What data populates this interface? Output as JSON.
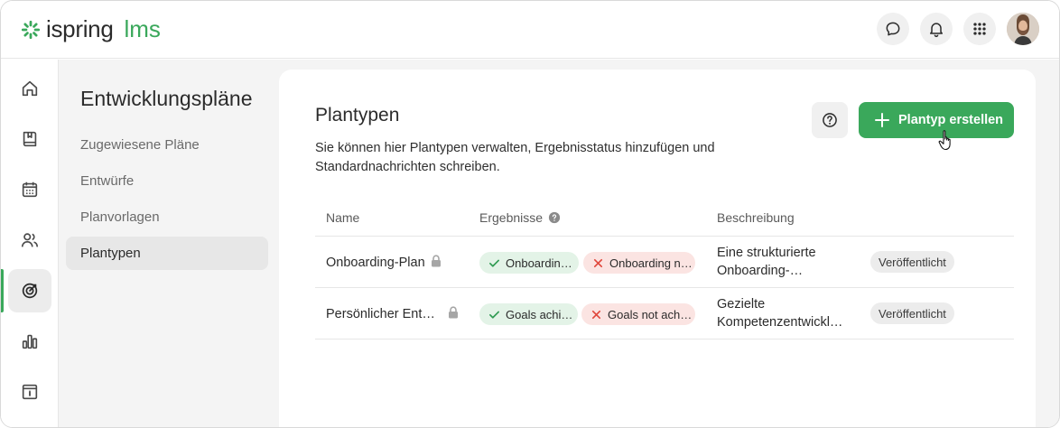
{
  "header": {
    "logo_word": "ispring",
    "logo_suffix": "lms",
    "brand_color": "#3aa85b",
    "icons": [
      "chat-icon",
      "bell-icon",
      "apps-grid-icon"
    ]
  },
  "rail": {
    "items": [
      "home-icon",
      "book-icon",
      "calendar-icon",
      "users-icon",
      "target-icon",
      "bar-chart-icon",
      "info-box-icon"
    ],
    "active_index": 4
  },
  "subnav": {
    "title": "Entwicklungspläne",
    "items": [
      {
        "label": "Zugewiesene Pläne"
      },
      {
        "label": "Entwürfe"
      },
      {
        "label": "Planvorlagen"
      },
      {
        "label": "Plantypen"
      }
    ],
    "active_index": 3
  },
  "main": {
    "title": "Plantypen",
    "description": "Sie können hier Plantypen verwalten, Ergebnisstatus hinzufügen und Standardnachrichten schreiben.",
    "create_label": "Plantyp erstellen",
    "table": {
      "columns": [
        "Name",
        "Ergebnisse",
        "Beschreibung"
      ],
      "rows": [
        {
          "name": "Onboarding-Plan",
          "result_ok": "Onboardin…",
          "result_fail": "Onboarding n…",
          "description": "Eine strukturierte Onboarding-…",
          "status": "Veröffentlicht"
        },
        {
          "name": "Persönlicher Ent…",
          "result_ok": "Goals achi…",
          "result_fail": "Goals not ach…",
          "description": "Gezielte Kompetenzentwickl…",
          "status": "Veröffentlicht"
        }
      ]
    }
  }
}
